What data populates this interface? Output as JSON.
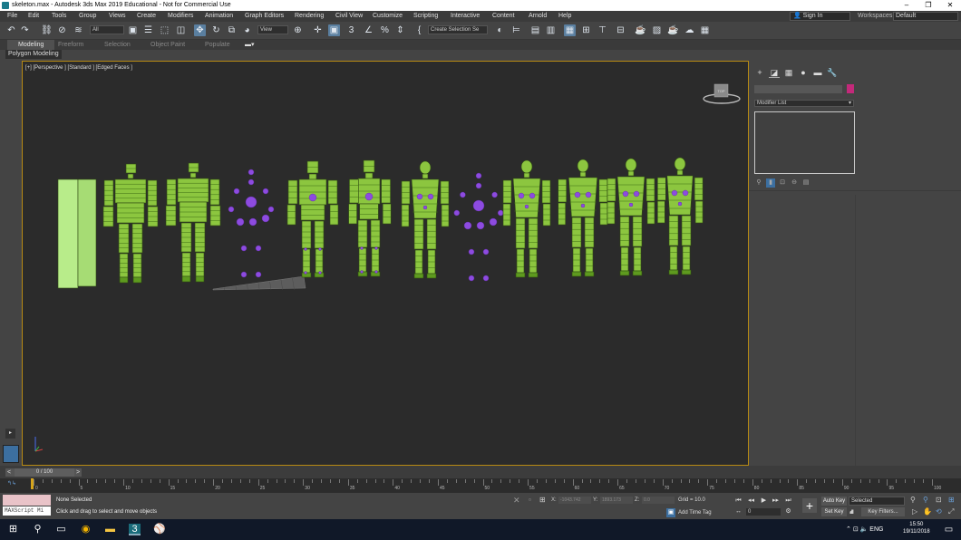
{
  "window": {
    "title": "skeleton.max - Autodesk 3ds Max 2019 Educational - Not for Commercial Use",
    "controls": [
      "–",
      "❐",
      "✕"
    ]
  },
  "menu": [
    "File",
    "Edit",
    "Tools",
    "Group",
    "Views",
    "Create",
    "Modifiers",
    "Animation",
    "Graph Editors",
    "Rendering",
    "Civil View",
    "Customize",
    "Scripting",
    "Interactive",
    "Content",
    "Arnold",
    "Help"
  ],
  "signin": "Sign In",
  "workspaces_label": "Workspaces:",
  "workspace_value": "Default",
  "toolbar": {
    "filter_value": "All",
    "refcoord_value": "View",
    "selection_set": "Create Selection Se"
  },
  "ribbon": {
    "tabs": [
      "Modeling",
      "Freeform",
      "Selection",
      "Object Paint",
      "Populate"
    ],
    "panel": "Polygon Modeling"
  },
  "viewport": {
    "label": "[+] [Perspective ] [Standard ] [Edged Faces ]",
    "colors": {
      "mesh": "#8cc63f",
      "mesh_dark": "#5e9a1f",
      "bone": "#8d4be0",
      "box": "#b8ec8a",
      "border": "#b88b13"
    }
  },
  "command_panel": {
    "modifier_list": "Modifier List",
    "swatch_color": "#c3297a"
  },
  "timeline": {
    "slider": "0 / 100",
    "ticks": [
      0,
      5,
      10,
      15,
      20,
      25,
      30,
      35,
      40,
      45,
      50,
      55,
      60,
      65,
      70,
      75,
      80,
      85,
      90,
      95,
      100
    ],
    "current_frame": 0
  },
  "status": {
    "selection": "None Selected",
    "prompt": "Click and drag to select and move objects",
    "maxscript": "MAXScript Mi",
    "x_label": "X:",
    "x_value": "-1043.742",
    "y_label": "Y:",
    "y_value": "1893.173",
    "z_label": "Z:",
    "z_value": "0.0",
    "grid": "Grid = 10.0",
    "add_time_tag": "Add Time Tag",
    "frame": "0",
    "auto_key": "Auto Key",
    "set_key": "Set Key",
    "key_mode": "Selected",
    "key_filters": "Key Filters..."
  },
  "taskbar": {
    "tray_lang": "ENG",
    "time": "15:50",
    "date": "19/11/2018"
  }
}
